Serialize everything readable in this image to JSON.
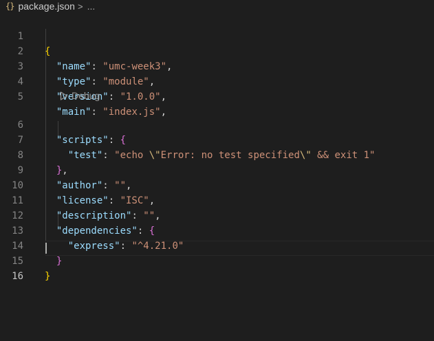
{
  "breadcrumb": {
    "icon": "{}",
    "file": "package.json",
    "separator": ">",
    "more": "..."
  },
  "codelens": {
    "label": "Debug"
  },
  "editor": {
    "lines": [
      {
        "num": "1",
        "b1": "{"
      },
      {
        "num": "2",
        "key": "\"name\"",
        "colon": ": ",
        "val": "\"umc-week3\"",
        "comma": ","
      },
      {
        "num": "3",
        "key": "\"type\"",
        "colon": ": ",
        "val": "\"module\"",
        "comma": ","
      },
      {
        "num": "4",
        "key": "\"version\"",
        "colon": ": ",
        "val": "\"1.0.0\"",
        "comma": ","
      },
      {
        "num": "5",
        "key": "\"main\"",
        "colon": ": ",
        "val": "\"index.js\"",
        "comma": ","
      },
      {
        "num": "6",
        "key": "\"scripts\"",
        "colon": ": ",
        "b2": "{"
      },
      {
        "num": "7",
        "key": "\"test\"",
        "colon": ": ",
        "v1": "\"echo ",
        "e1": "\\\"",
        "v2": "Error: no test specified",
        "e2": "\\\"",
        "v3": " && exit 1\""
      },
      {
        "num": "8",
        "b2": "}",
        "comma": ","
      },
      {
        "num": "9",
        "key": "\"author\"",
        "colon": ": ",
        "val": "\"\"",
        "comma": ","
      },
      {
        "num": "10",
        "key": "\"license\"",
        "colon": ": ",
        "val": "\"ISC\"",
        "comma": ","
      },
      {
        "num": "11",
        "key": "\"description\"",
        "colon": ": ",
        "val": "\"\"",
        "comma": ","
      },
      {
        "num": "12",
        "key": "\"dependencies\"",
        "colon": ": ",
        "b2": "{"
      },
      {
        "num": "13",
        "key": "\"express\"",
        "colon": ": ",
        "val": "\"^4.21.0\""
      },
      {
        "num": "14",
        "b2": "}"
      },
      {
        "num": "15",
        "b1": "}"
      },
      {
        "num": "16"
      }
    ]
  },
  "colors": {
    "background": "#1e1e1e",
    "key": "#9cdcfe",
    "string": "#ce9178",
    "bracket_level1": "#ffd700",
    "bracket_level2": "#da70d6",
    "line_number": "#858585"
  }
}
